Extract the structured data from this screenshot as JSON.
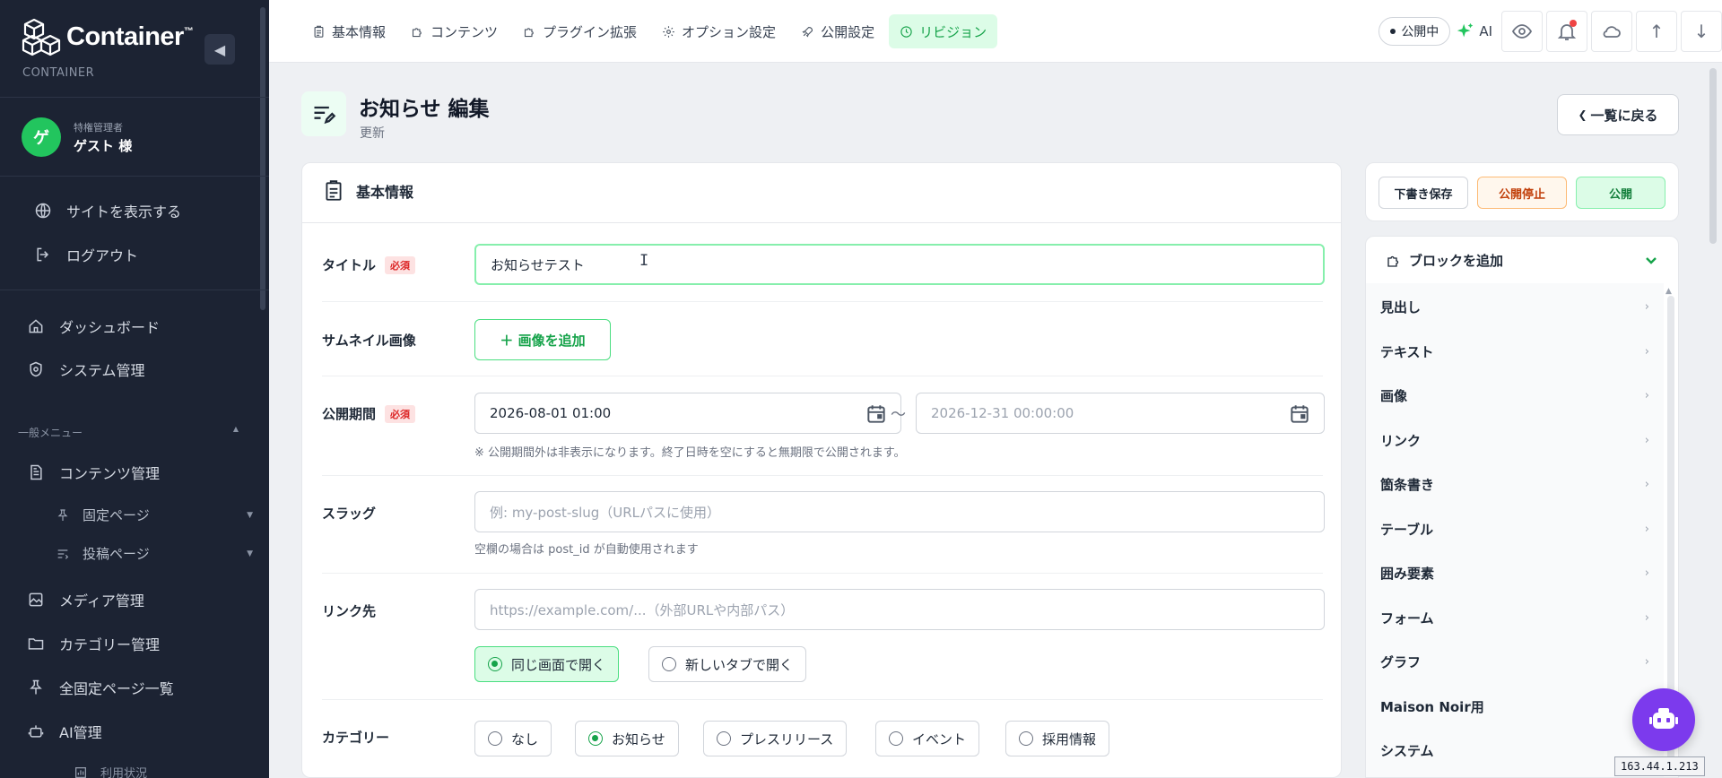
{
  "brand": {
    "name": "Container",
    "tm": "™",
    "subtitle": "CONTAINER",
    "collapse_icon": "triangle-left-icon"
  },
  "user": {
    "initial": "ゲ",
    "role": "特権管理者",
    "name": "ゲスト 様"
  },
  "sidebar": {
    "links": [
      {
        "label": "サイトを表示する",
        "icon": "globe-icon"
      },
      {
        "label": "ログアウト",
        "icon": "logout-icon"
      }
    ],
    "items": [
      {
        "label": "ダッシュボード",
        "icon": "home-icon"
      },
      {
        "label": "システム管理",
        "icon": "system-icon"
      }
    ],
    "section_label": "一般メニュー",
    "section_caret": "▲",
    "content_label": "コンテンツ管理",
    "subitems": [
      {
        "label": "固定ページ",
        "icon": "pin-icon",
        "caret": "▼"
      },
      {
        "label": "投稿ページ",
        "icon": "list-icon",
        "caret": "▼"
      }
    ],
    "items2": [
      {
        "label": "メディア管理",
        "icon": "image-icon"
      },
      {
        "label": "カテゴリー管理",
        "icon": "folder-icon"
      },
      {
        "label": "全固定ページ一覧",
        "icon": "pin-icon"
      },
      {
        "label": "AI管理",
        "icon": "robot-icon"
      }
    ],
    "clipped_sub": "利用状況"
  },
  "topbar": {
    "tabs": [
      {
        "label": "基本情報",
        "icon": "clipboard-icon"
      },
      {
        "label": "コンテンツ",
        "icon": "puzzle-icon"
      },
      {
        "label": "プラグイン拡張",
        "icon": "puzzle-icon"
      },
      {
        "label": "オプション設定",
        "icon": "gear-icon"
      },
      {
        "label": "公開設定",
        "icon": "rocket-icon"
      },
      {
        "label": "リビジョン",
        "icon": "clock-icon",
        "active": true
      }
    ],
    "status": "公開中",
    "ai_label": "AI",
    "up_arrow": "↑",
    "down_arrow": "↓"
  },
  "page": {
    "title": "お知らせ 編集",
    "subtitle": "更新",
    "back_label": "一覧に戻る",
    "back_chevron": "❮"
  },
  "form": {
    "section_title": "基本情報",
    "required_badge": "必須",
    "title_label": "タイトル",
    "title_value": "お知らせテスト",
    "thumb_label": "サムネイル画像",
    "add_image": "＋ 画像を追加",
    "period_label": "公開期間",
    "period_start": "2026-08-01 01:00",
    "period_tilde": "〜",
    "period_end_placeholder": "2026-12-31 00:00:00",
    "period_help": "※ 公開期間外は非表示になります。終了日時を空にすると無期限で公開されます。",
    "slug_label": "スラッグ",
    "slug_placeholder": "例: my-post-slug（URLパスに使用）",
    "slug_help": "空欄の場合は post_id が自動使用されます",
    "link_label": "リンク先",
    "link_placeholder": "https://example.com/...（外部URLや内部パス）",
    "open_same": "同じ画面で開く",
    "open_new": "新しいタブで開く",
    "category_label": "カテゴリー",
    "categories": [
      "なし",
      "お知らせ",
      "プレスリリース",
      "イベント",
      "採用情報"
    ],
    "category_selected": "お知らせ"
  },
  "actions": {
    "draft": "下書き保存",
    "unpublish": "公開停止",
    "publish": "公開"
  },
  "blocks": {
    "title": "ブロックを追加",
    "chevron": "›",
    "items": [
      "見出し",
      "テキスト",
      "画像",
      "リンク",
      "箇条書き",
      "テーブル",
      "囲み要素",
      "フォーム",
      "グラフ",
      "Maison Noir用",
      "システム"
    ],
    "scroll_up": "▲"
  },
  "ip": "163.44.1.213",
  "cursor_glyph": "I",
  "colors": {
    "sidebar": "#1c2333",
    "accent": "#16a34a",
    "accent_bg": "#dcfce7",
    "danger": "#dc2626",
    "bot": "#7c3aed"
  }
}
